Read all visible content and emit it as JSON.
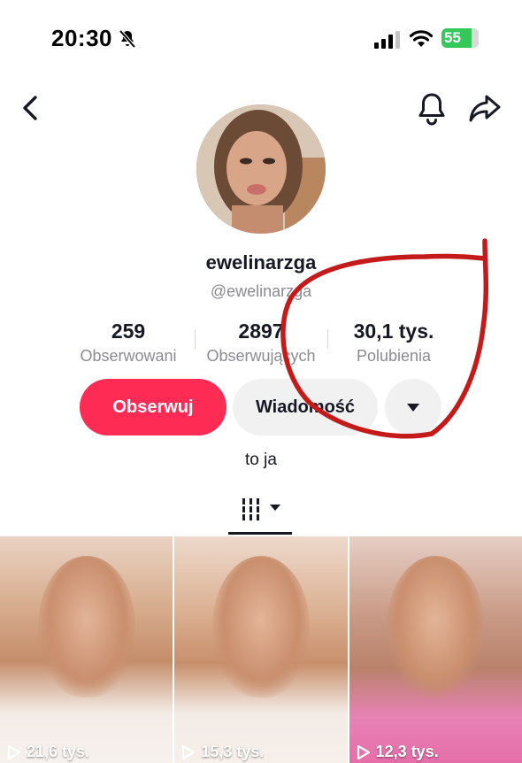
{
  "status_bar": {
    "time": "20:30",
    "battery": "55"
  },
  "profile": {
    "username": "ewelinarzga",
    "handle": "@ewelinarzga",
    "bio": "to ja"
  },
  "stats": [
    {
      "value": "259",
      "label": "Obserwowani"
    },
    {
      "value": "2897",
      "label": "Obserwujących"
    },
    {
      "value": "30,1 tys.",
      "label": "Polubienia"
    }
  ],
  "actions": {
    "follow_label": "Obserwuj",
    "message_label": "Wiadomość"
  },
  "videos": [
    {
      "views": "21,6 tys."
    },
    {
      "views": "15,3 tys."
    },
    {
      "views": "12,3 tys."
    }
  ],
  "colors": {
    "accent": "#fe2c55",
    "annotation": "#c41a1a",
    "battery": "#34c759"
  }
}
